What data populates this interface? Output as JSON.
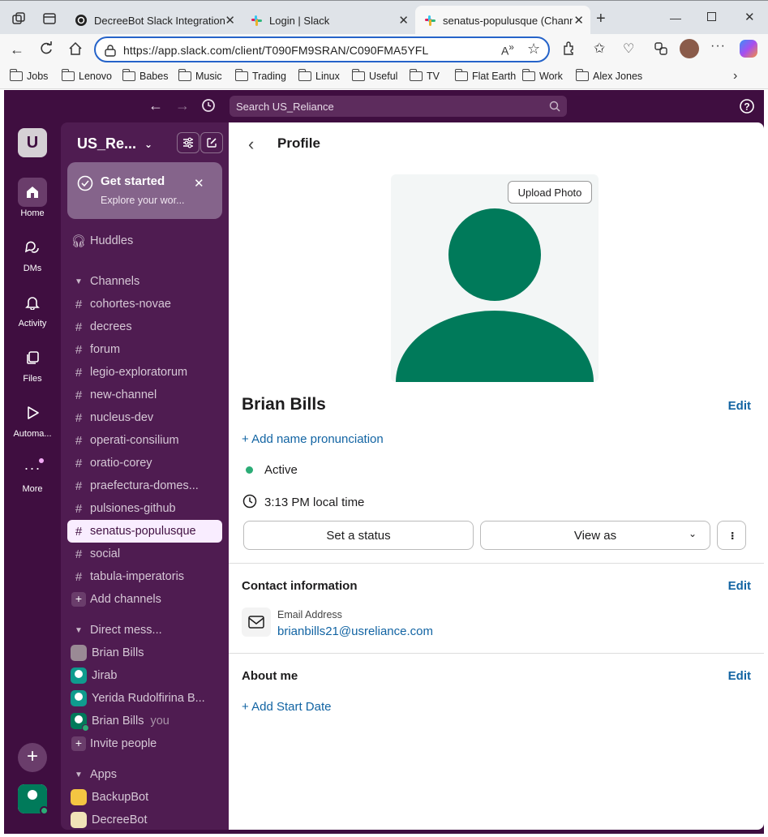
{
  "browser": {
    "tabs": [
      {
        "title": "DecreeBot Slack Integration"
      },
      {
        "title": "Login | Slack"
      },
      {
        "title": "senatus-populusque (Chann"
      }
    ],
    "url": "https://app.slack.com/client/T090FM9SRAN/C090FMA5YFL",
    "bookmarks": [
      "Jobs",
      "Lenovo",
      "Babes",
      "Music",
      "Trading",
      "Linux",
      "Useful",
      "TV",
      "Flat Earth",
      "Work",
      "Alex Jones"
    ]
  },
  "slack": {
    "search_placeholder": "Search US_Reliance",
    "workspace_initial": "U",
    "workspace_name": "US_Re...",
    "rail": [
      "Home",
      "DMs",
      "Activity",
      "Files",
      "Automa...",
      "More"
    ],
    "get_started": {
      "title": "Get started",
      "subtitle": "Explore your wor..."
    },
    "huddles": "Huddles",
    "channels_header": "Channels",
    "channels": [
      "cohortes-novae",
      "decrees",
      "forum",
      "legio-exploratorum",
      "new-channel",
      "nucleus-dev",
      "operati-consilium",
      "oratio-corey",
      "praefectura-domes...",
      "pulsiones-github",
      "senatus-populusque",
      "social",
      "tabula-imperatoris"
    ],
    "add_channels": "Add channels",
    "dm_header": "Direct mess...",
    "dms": [
      {
        "name": "Brian Bills",
        "suffix": ""
      },
      {
        "name": "Jirab",
        "suffix": ""
      },
      {
        "name": "Yerida Rudolfirina B...",
        "suffix": ""
      },
      {
        "name": "Brian Bills",
        "suffix": "you"
      }
    ],
    "invite": "Invite people",
    "apps_header": "Apps",
    "apps": [
      "BackupBot",
      "DecreeBot"
    ]
  },
  "profile": {
    "header": "Profile",
    "upload_photo": "Upload Photo",
    "name": "Brian Bills",
    "edit": "Edit",
    "add_pronunciation": "Add name pronunciation",
    "status": "Active",
    "local_time": "3:13 PM",
    "local_time_suffix": "local time",
    "set_status": "Set a status",
    "view_as": "View as",
    "contact_header": "Contact information",
    "email_label": "Email Address",
    "email": "brianbills21@usreliance.com",
    "about_header": "About me",
    "add_start_date": "Add Start Date"
  },
  "colors": {
    "aubergine": "#3f0e40",
    "sidebar": "#4f1c51",
    "accent_link": "#1264a3",
    "avatar_green": "#007a5a",
    "active_dot": "#2bac76"
  }
}
